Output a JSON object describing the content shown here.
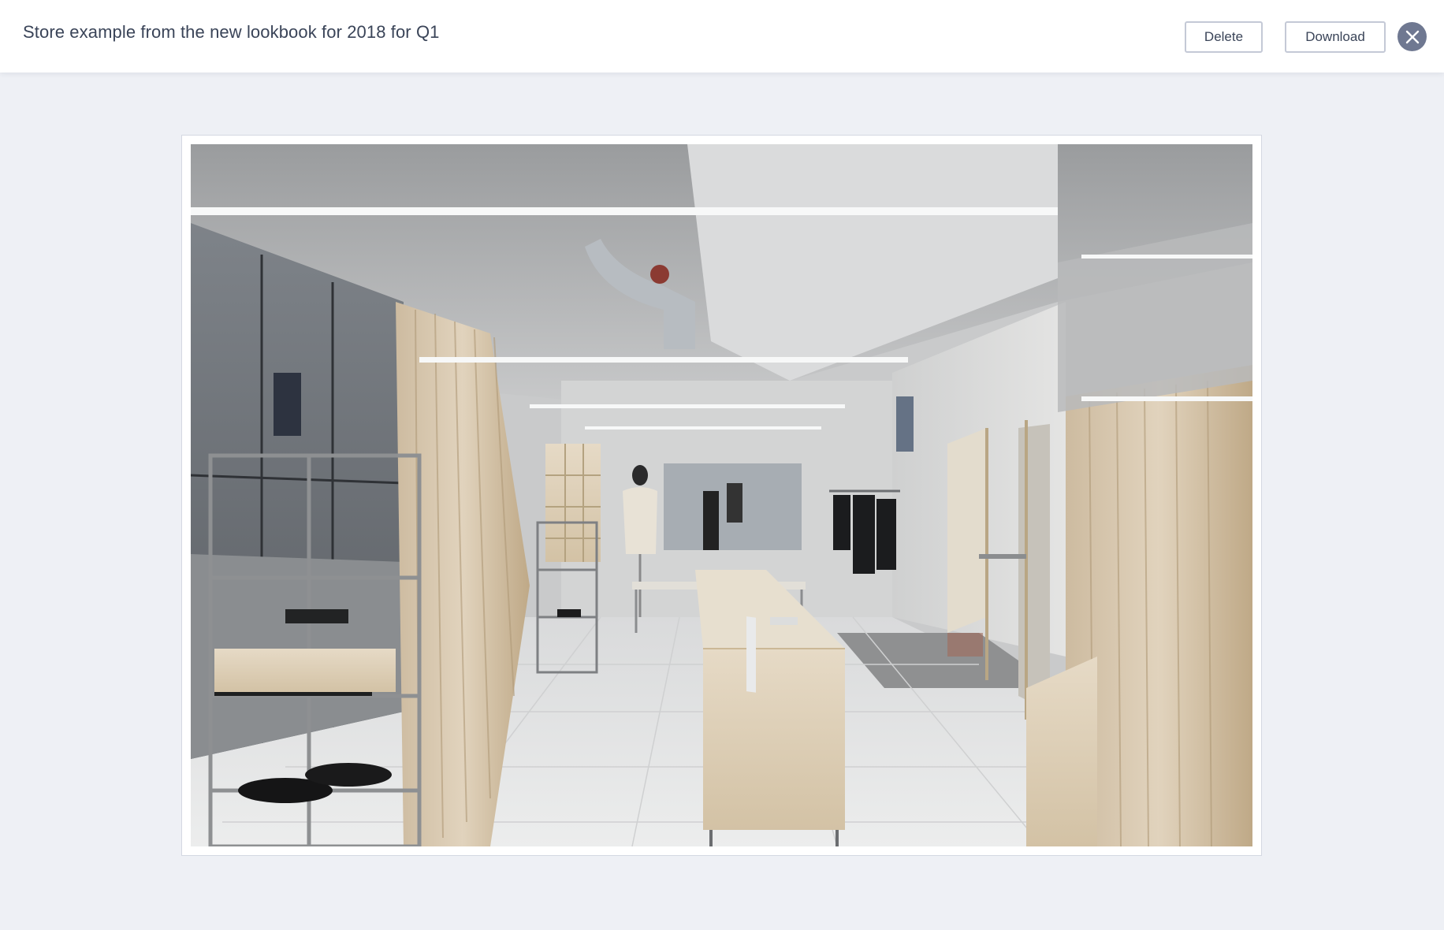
{
  "header": {
    "title": "Store example from the new lookbook for 2018 for Q1",
    "delete_label": "Delete",
    "download_label": "Download",
    "close_icon": "close-icon"
  },
  "preview": {
    "image_subject": "minimalist clothing store interior",
    "frame_color": "#ffffff",
    "page_background": "#eef0f5"
  },
  "colors": {
    "title_text": "#3a4458",
    "button_border": "#c4c9d6",
    "close_button": "#6f7891"
  }
}
